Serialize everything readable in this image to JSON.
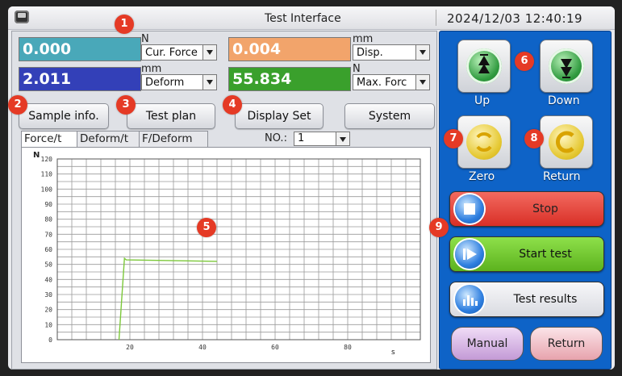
{
  "titlebar": {
    "title": "Test Interface",
    "datetime": "2024/12/03   12:40:19"
  },
  "readouts": [
    {
      "value": "0.000",
      "unit": "N",
      "select": "Cur. Force",
      "color": "#49a8b9"
    },
    {
      "value": "2.011",
      "unit": "mm",
      "select": "Deform",
      "color": "#3340b8"
    },
    {
      "value": "0.004",
      "unit": "mm",
      "select": "Disp.",
      "color": "#f2a46b"
    },
    {
      "value": "55.834",
      "unit": "N",
      "select": "Max. Forc",
      "color": "#3aa02c"
    }
  ],
  "buttons": {
    "sample_info": "Sample info.",
    "test_plan": "Test plan",
    "display_set": "Display Set",
    "system": "System"
  },
  "tabs": [
    "Force/t",
    "Deform/t",
    "F/Deform"
  ],
  "no_label": "NO.:",
  "no_value": "1",
  "right": {
    "up": "Up",
    "down": "Down",
    "zero": "Zero",
    "return_top": "Return",
    "stop": "Stop",
    "start": "Start test",
    "results": "Test results",
    "manual": "Manual",
    "return_bottom": "Return"
  },
  "badges": [
    "1",
    "2",
    "3",
    "4",
    "5",
    "6",
    "7",
    "8",
    "9"
  ],
  "colors": {
    "stop": "#e8433a",
    "start": "#6cc32a",
    "results": "#e7e8ed",
    "manual": "#d9b9e6",
    "return": "#f0c0c8"
  },
  "chart_data": {
    "type": "line",
    "ylabel": "N",
    "xlabel": "s",
    "y_ticks": [
      "120",
      "110",
      "100",
      "90",
      "80",
      "70",
      "60",
      "50",
      "40",
      "30",
      "20",
      "10",
      "0"
    ],
    "x_ticks": [
      "20",
      "40",
      "60",
      "80"
    ],
    "xlim": [
      0,
      100
    ],
    "ylim": [
      0,
      120
    ],
    "grid": true,
    "series": [
      {
        "x": [
          17,
          18.5,
          19,
          44
        ],
        "y": [
          0,
          54,
          53,
          52
        ]
      }
    ]
  }
}
